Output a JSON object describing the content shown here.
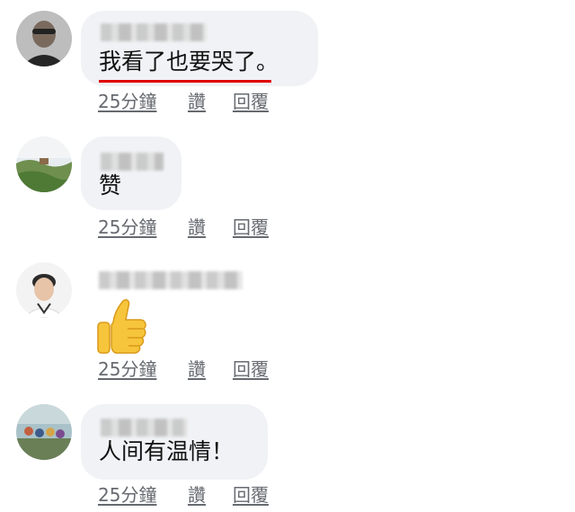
{
  "comments": [
    {
      "text": "我看了也要哭了。",
      "time": "25分鐘",
      "like_label": "讚",
      "reply_label": "回覆"
    },
    {
      "text": "赞",
      "time": "25分鐘",
      "like_label": "讚",
      "reply_label": "回覆"
    },
    {
      "text": "",
      "sticker": "thumbs-up-emoji",
      "time": "25分鐘",
      "like_label": "讚",
      "reply_label": "回覆"
    },
    {
      "text": "人间有温情！",
      "time": "25分鐘",
      "like_label": "讚",
      "reply_label": "回覆"
    }
  ],
  "colors": {
    "bubble": "#f0f2f5",
    "action_text": "#666a70",
    "highlight_underline": "#e00000",
    "emoji_yellow": "#f7c53b"
  }
}
